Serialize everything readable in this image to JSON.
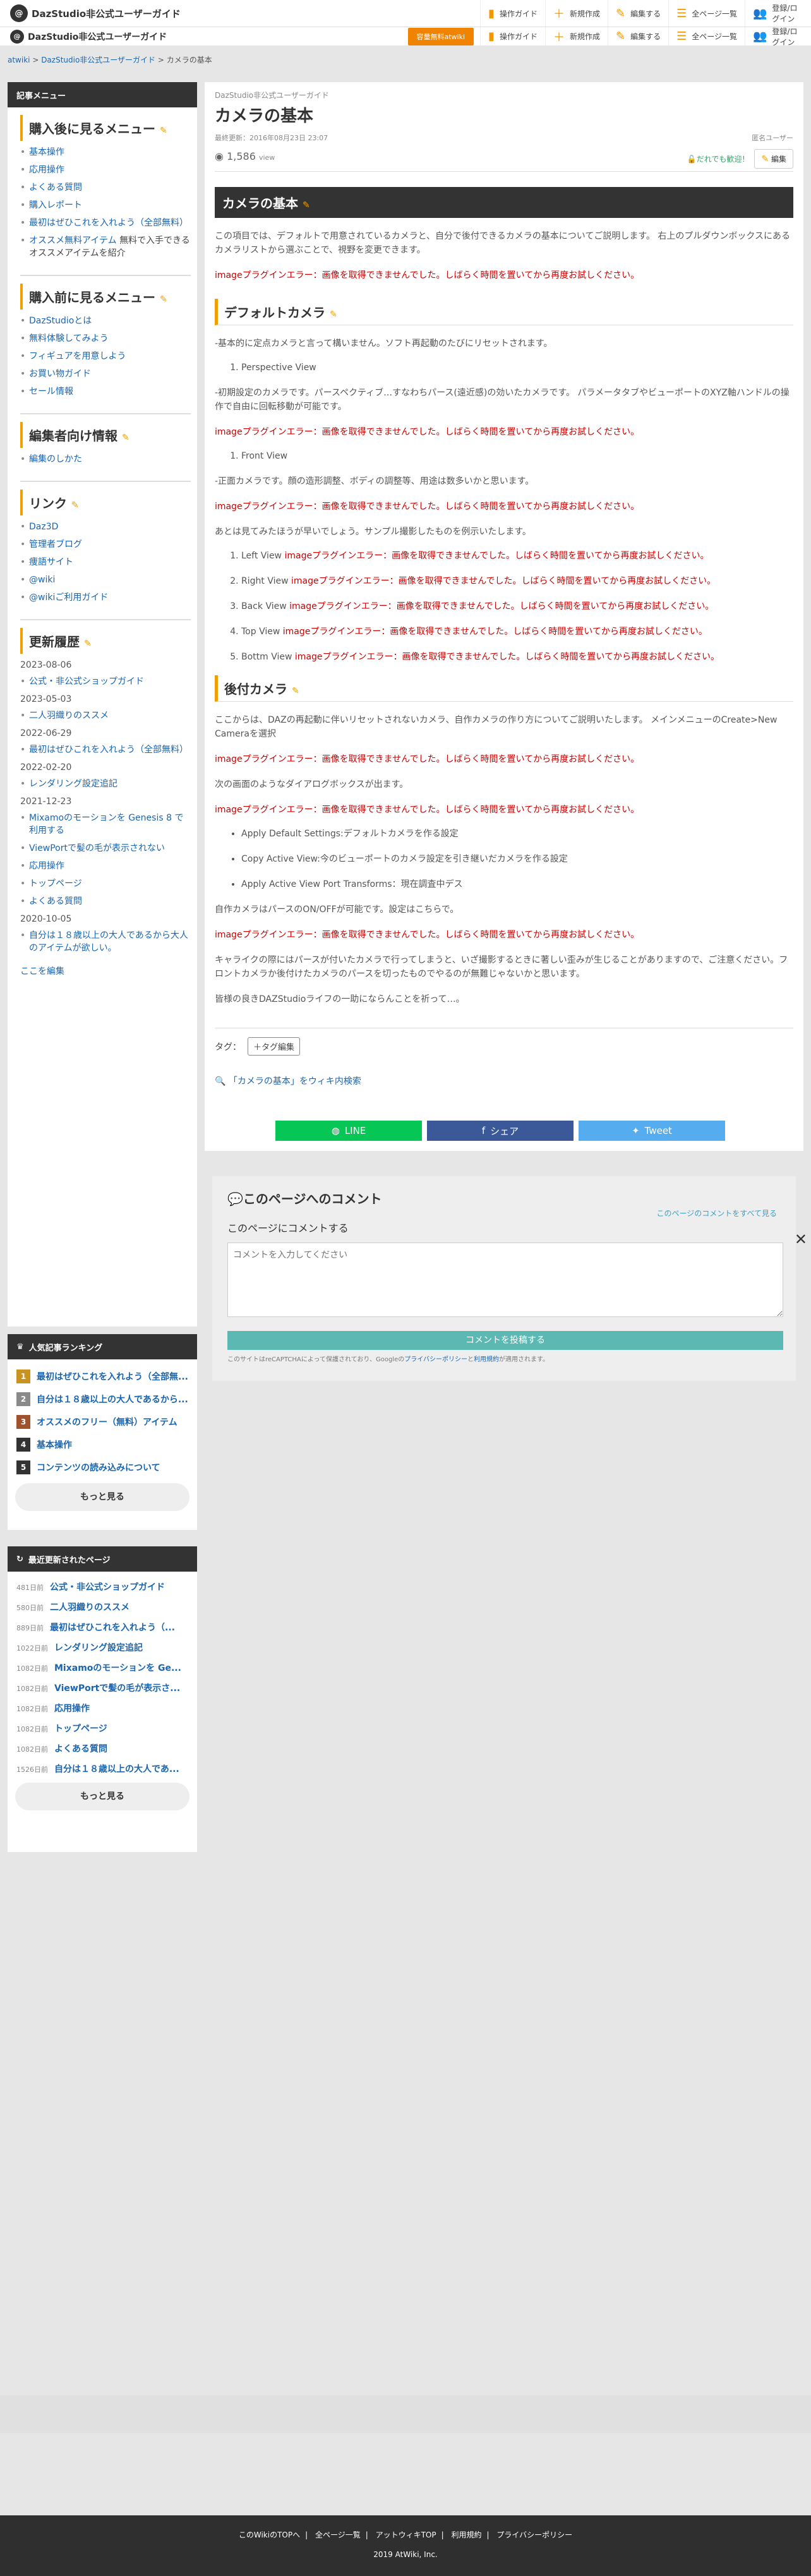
{
  "header": {
    "site_title": "DazStudio非公式ユーザーガイド",
    "logo_letter": "@",
    "nav": [
      {
        "label": "操作ガイド",
        "icon": "guide-icon"
      },
      {
        "label": "新規作成",
        "icon": "plus-icon"
      },
      {
        "label": "編集する",
        "icon": "pencil-icon"
      },
      {
        "label": "全ページ一覧",
        "icon": "list-icon"
      },
      {
        "label": "登録/ログイン",
        "icon": "users-icon"
      }
    ],
    "badge": "容量無料atwiki"
  },
  "breadcrumb": {
    "root": "atwiki",
    "wiki": "DazStudio非公式ユーザーガイド",
    "page": "カメラの基本"
  },
  "sidebar": {
    "menu_title": "記事メニュー",
    "after_title": "購入後に見るメニュー",
    "after_items": [
      "基本操作",
      "応用操作",
      "よくある質問",
      "購入レポート",
      "最初はぜひこれを入れよう（全部無料）",
      "オススメ無料アイテム"
    ],
    "after_item_note": "無料で入手できるオススメアイテムを紹介",
    "before_title": "購入前に見るメニュー",
    "before_items": [
      "DazStudioとは",
      "無料体験してみよう",
      "フィギュアを用意しよう",
      "お買い物ガイド",
      "セール情報"
    ],
    "editor_title": "編集者向け情報",
    "editor_items": [
      "編集のしかた"
    ],
    "links_title": "リンク",
    "links_items": [
      "Daz3D",
      "管理者ブログ",
      "痩語サイト",
      "@wiki",
      "@wikiご利用ガイド"
    ],
    "history_title": "更新履歴",
    "history": [
      {
        "date": "2023-08-06",
        "items": [
          "公式・非公式ショップガイド"
        ]
      },
      {
        "date": "2023-05-03",
        "items": [
          "二人羽織りのススメ"
        ]
      },
      {
        "date": "2022-06-29",
        "items": [
          "最初はぜひこれを入れよう（全部無料）"
        ]
      },
      {
        "date": "2022-02-20",
        "items": [
          "レンダリング設定追記"
        ]
      },
      {
        "date": "2021-12-23",
        "items": [
          "Mixamoのモーションを Genesis 8 で利用する",
          "ViewPortで髪の毛が表示されない",
          "応用操作",
          "トップページ",
          "よくある質問"
        ]
      },
      {
        "date": "2020-10-05",
        "items": [
          "自分は１８歳以上の大人であるから大人のアイテムが欲しい。"
        ]
      }
    ],
    "history_edit": "ここを編集",
    "ranking_title": "人気記事ランキング",
    "ranking": [
      "最初はぜひこれを入れよう（全部無...",
      "自分は１８歳以上の大人であるから...",
      "オススメのフリー（無料）アイテム",
      "基本操作",
      "コンテンツの読み込みについて"
    ],
    "more": "もっと見る",
    "recent_title": "最近更新されたページ",
    "recent": [
      {
        "ago": "481日前",
        "title": "公式・非公式ショップガイド"
      },
      {
        "ago": "580日前",
        "title": "二人羽織りのススメ"
      },
      {
        "ago": "889日前",
        "title": "最初はぜひこれを入れよう（..."
      },
      {
        "ago": "1022日前",
        "title": "レンダリング設定追記"
      },
      {
        "ago": "1082日前",
        "title": "Mixamoのモーションを Ge..."
      },
      {
        "ago": "1082日前",
        "title": "ViewPortで髪の毛が表示さ..."
      },
      {
        "ago": "1082日前",
        "title": "応用操作"
      },
      {
        "ago": "1082日前",
        "title": "トップページ"
      },
      {
        "ago": "1082日前",
        "title": "よくある質問"
      },
      {
        "ago": "1526日前",
        "title": "自分は１８歳以上の大人であ..."
      }
    ]
  },
  "article": {
    "wiki_name": "DazStudio非公式ユーザーガイド",
    "title": "カメラの基本",
    "updated": "最終更新：2016年08月23日 23:07",
    "author": "匿名ユーザー",
    "views": "1,586",
    "views_unit": "view",
    "help_link": "だれでも歓迎！",
    "edit": "編集",
    "h2": "カメラの基本",
    "intro": "この項目では、デフォルトで用意されているカメラと、自分で後付できるカメラの基本についてご説明します。 右上のプルダウンボックスにあるカメラリストから選ぶことで、視野を変更できます。",
    "error": "imageプラグインエラー：画像を取得できませんでした。しばらく時間を置いてから再度お試しください。",
    "h3_default": "デフォルトカメラ",
    "default_p1": "-基本的に定点カメラと言って構いません。ソフト再起動のたびにリセットされます。",
    "default_l1": "Perspective View",
    "default_p2": "-初期設定のカメラです。パースペクティブ…すなわちパース(遠近感)の効いたカメラです。 パラメータタブやビューポートのXYZ軸ハンドルの操作で自由に回転移動が可能です。",
    "default_l2": "Front View",
    "default_p3": "-正面カメラです。顔の造形調整、ボディの調整等、用途は数多いかと思います。",
    "default_p4": "あとは見てみたほうが早いでしょう。サンプル撮影したものを例示いたします。",
    "views_list": [
      "Left View",
      "Right View",
      "Back View",
      "Top View",
      "Bottm View"
    ],
    "h3_after": "後付カメラ",
    "after_p1": "ここからは、DAZの再起動に伴いリセットされないカメラ、自作カメラの作り方についてご説明いたします。 メインメニューのCreate>New Cameraを選択",
    "after_p2": "次の画面のようなダイアログボックスが出ます。",
    "after_list": [
      "Apply Default Settings:デフォルトカメラを作る設定",
      "Copy Active View:今のビューポートのカメラ設定を引き継いだカメラを作る設定",
      "Apply Active View Port Transforms：現在調査中デス"
    ],
    "after_p3": "自作カメラはパースのON/OFFが可能です。設定はこちらで。",
    "after_p4": "キャライクの際にはパースが付いたカメラで行ってしまうと、いざ撮影するときに著しい歪みが生じることがありますので、ご注意ください。フロントカメラか後付けたカメラのパースを切ったものでやるのが無難じゃないかと思います。",
    "after_p5": "皆様の良きDAZStudioライフの一助にならんことを祈って…。",
    "tag_label": "タグ：",
    "tag_btn": "＋タグ編集",
    "search": "「カメラの基本」をウィキ内検索"
  },
  "share": {
    "line": "LINE",
    "facebook": "シェア",
    "twitter": "Tweet"
  },
  "comments": {
    "title": "このページへのコメント",
    "all_link": "このページのコメントをすべて見る",
    "label": "このページにコメントする",
    "placeholder": "コメントを入力してください",
    "submit": "コメントを投稿する",
    "captcha_prefix": "このサイトはreCAPTCHAによって保護されており、Googleの",
    "privacy": "プライバシーポリシー",
    "and": "と",
    "terms": "利用規約",
    "captcha_suffix": "が適用されます。"
  },
  "footer": {
    "links": [
      "このWikiのTOPへ",
      "全ページ一覧",
      "アットウィキTOP",
      "利用規約",
      "プライバシーポリシー"
    ],
    "copy": "2019 AtWiki, Inc."
  },
  "colors": {
    "accent": "#f0a000",
    "rank": [
      "#c8941f",
      "#8a8a8a",
      "#a0522d",
      "#333333",
      "#333333"
    ],
    "line": "#06c755",
    "facebook": "#3b5998",
    "twitter": "#55acee"
  }
}
